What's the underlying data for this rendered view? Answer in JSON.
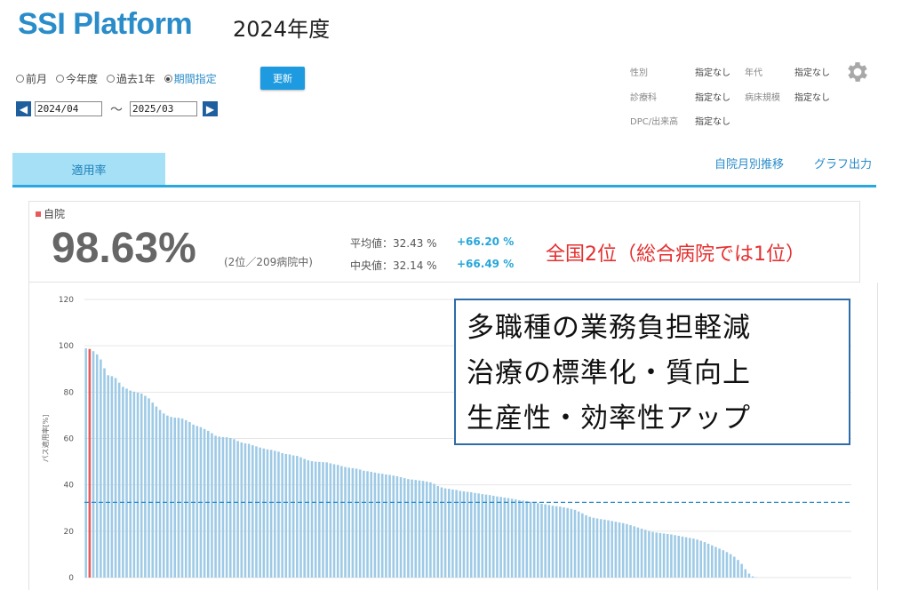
{
  "header": {
    "logo": "SSI Platform",
    "fiscal_year": "2024年度"
  },
  "period": {
    "options": [
      {
        "label": "前月",
        "checked": false
      },
      {
        "label": "今年度",
        "checked": false
      },
      {
        "label": "過去1年",
        "checked": false
      },
      {
        "label": "期間指定",
        "checked": true
      }
    ],
    "update_label": "更新",
    "from": "2024/04",
    "to": "2025/03",
    "tilde": "〜",
    "prev_icon": "chevron-left-icon",
    "next_icon": "chevron-right-icon"
  },
  "filters": {
    "sex_label": "性別",
    "sex_value": "指定なし",
    "age_label": "年代",
    "age_value": "指定なし",
    "dept_label": "診療科",
    "dept_value": "指定なし",
    "beds_label": "病床規模",
    "beds_value": "指定なし",
    "dpc_label": "DPC/出来高",
    "dpc_value": "指定なし",
    "settings_icon": "gear-icon"
  },
  "tabs": {
    "active": "適用率",
    "links": [
      "自院月別推移",
      "グラフ出力"
    ]
  },
  "summary": {
    "own_label": "自院",
    "rate": "98.63%",
    "rank": "(2位／209病院中)",
    "avg_label": "平均値：32.43 %",
    "avg_diff": "+66.20 %",
    "median_label": "中央値：32.14 %",
    "median_diff": "+66.49 %",
    "colors": {
      "own": "#e85a5a",
      "diff": "#27a6d9"
    }
  },
  "annotation_red": "全国2位（総合病院では1位）",
  "textbox_lines": [
    "多職種の業務負担軽減",
    "治療の標準化・質向上",
    "生産性・効率性アップ"
  ],
  "chart_data": {
    "type": "bar",
    "ylabel": "パス適用率[%]",
    "ylim": [
      0,
      120
    ],
    "yticks": [
      0,
      20,
      40,
      60,
      80,
      100,
      120
    ],
    "hospital_count": 209,
    "own_rank": 2,
    "own_value": 98.63,
    "mean_line": 32.43,
    "grid": true,
    "colors": {
      "bar": "#9ecae6",
      "own": "#e85a5a",
      "mean": "#2a8cc9"
    },
    "values": [
      98.9,
      98.63,
      97.7,
      96.3,
      94.1,
      90.3,
      87.3,
      86.9,
      86.1,
      84.1,
      82.3,
      81.5,
      80.7,
      80.2,
      79.8,
      79.4,
      78.4,
      77.3,
      75.5,
      73.8,
      72.3,
      70.8,
      69.9,
      69.3,
      69.0,
      68.9,
      68.6,
      67.9,
      67.1,
      66.0,
      65.4,
      64.9,
      64.1,
      63.3,
      62.3,
      61.2,
      60.8,
      60.6,
      60.5,
      60.2,
      59.7,
      58.9,
      58.3,
      57.9,
      57.7,
      57.1,
      56.6,
      56.1,
      55.7,
      55.3,
      55.1,
      54.7,
      54.3,
      53.7,
      53.3,
      53.1,
      52.7,
      52.5,
      51.9,
      51.2,
      50.6,
      50.2,
      50.0,
      49.9,
      49.8,
      49.7,
      49.3,
      48.9,
      48.6,
      48.1,
      47.7,
      47.4,
      47.2,
      47.0,
      46.6,
      46.1,
      45.9,
      45.6,
      45.3,
      45.0,
      44.8,
      44.5,
      44.3,
      44.0,
      43.7,
      43.3,
      42.9,
      42.5,
      42.3,
      42.1,
      41.9,
      41.7,
      41.4,
      41.1,
      40.4,
      39.5,
      38.9,
      38.5,
      38.3,
      38.0,
      37.8,
      37.4,
      37.2,
      37.0,
      36.8,
      36.5,
      36.3,
      36.0,
      35.8,
      35.6,
      35.3,
      35.0,
      34.8,
      34.5,
      34.3,
      34.0,
      33.7,
      33.4,
      33.2,
      33.0,
      32.7,
      32.4,
      32.1,
      31.8,
      31.6,
      31.3,
      31.0,
      30.8,
      30.6,
      30.3,
      30.0,
      29.6,
      29.2,
      28.5,
      27.7,
      26.9,
      26.2,
      25.8,
      25.5,
      25.2,
      25.0,
      24.7,
      24.4,
      24.1,
      23.8,
      23.5,
      23.1,
      22.6,
      22.1,
      21.6,
      21.1,
      20.6,
      20.1,
      19.7,
      19.4,
      19.2,
      19.0,
      18.8,
      18.6,
      18.3,
      18.0,
      17.7,
      17.4,
      17.1,
      16.8,
      16.4,
      15.9,
      15.3,
      14.6,
      13.9,
      13.2,
      12.5,
      11.8,
      11.0,
      10.1,
      9.0,
      7.6,
      5.9,
      3.6,
      1.7,
      0.5,
      0.1,
      0,
      0,
      0,
      0,
      0,
      0,
      0,
      0,
      0,
      0,
      0,
      0,
      0,
      0,
      0,
      0,
      0,
      0,
      0,
      0,
      0,
      0,
      0,
      0,
      0
    ]
  }
}
